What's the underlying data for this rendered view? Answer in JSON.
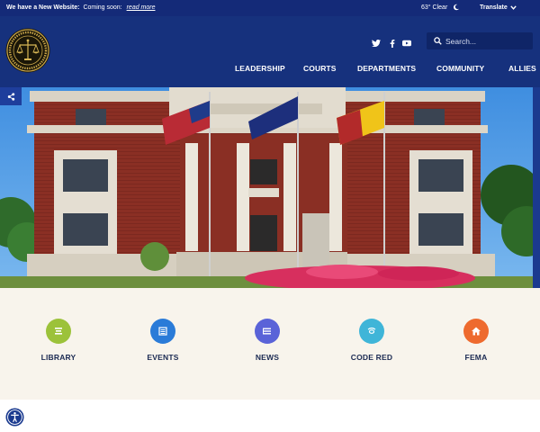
{
  "alert": {
    "headline": "We have a New Website:",
    "text": "Coming soon:",
    "link": "read more"
  },
  "weather": {
    "temperature": "63°",
    "condition": "Clear",
    "icon": "moon-icon"
  },
  "translate": {
    "label": "Translate"
  },
  "header": {
    "seal_icon": "county-seal-logo",
    "social": [
      "twitter-icon",
      "facebook-icon",
      "youtube-icon"
    ],
    "search": {
      "placeholder": "Search..."
    }
  },
  "nav": [
    "LEADERSHIP",
    "COURTS",
    "DEPARTMENTS",
    "COMMUNITY",
    "ALLIES"
  ],
  "hero": {
    "alt": "Courthouse building with flags and flower beds",
    "share_icon": "share-icon"
  },
  "quick_links": [
    {
      "label": "LIBRARY",
      "icon": "library-icon",
      "color": "#9cc23a"
    },
    {
      "label": "EVENTS",
      "icon": "calendar-list-icon",
      "color": "#2a7bd8"
    },
    {
      "label": "NEWS",
      "icon": "news-icon",
      "color": "#5a63d8"
    },
    {
      "label": "CODE RED",
      "icon": "alert-signal-icon",
      "color": "#3fb5d8"
    },
    {
      "label": "FEMA",
      "icon": "home-icon",
      "color": "#ee6a2e"
    }
  ],
  "accessibility": {
    "icon": "accessibility-icon"
  },
  "colors": {
    "topbar": "#142a78",
    "header": "#16317d",
    "quick_bg": "#f8f4ec"
  }
}
